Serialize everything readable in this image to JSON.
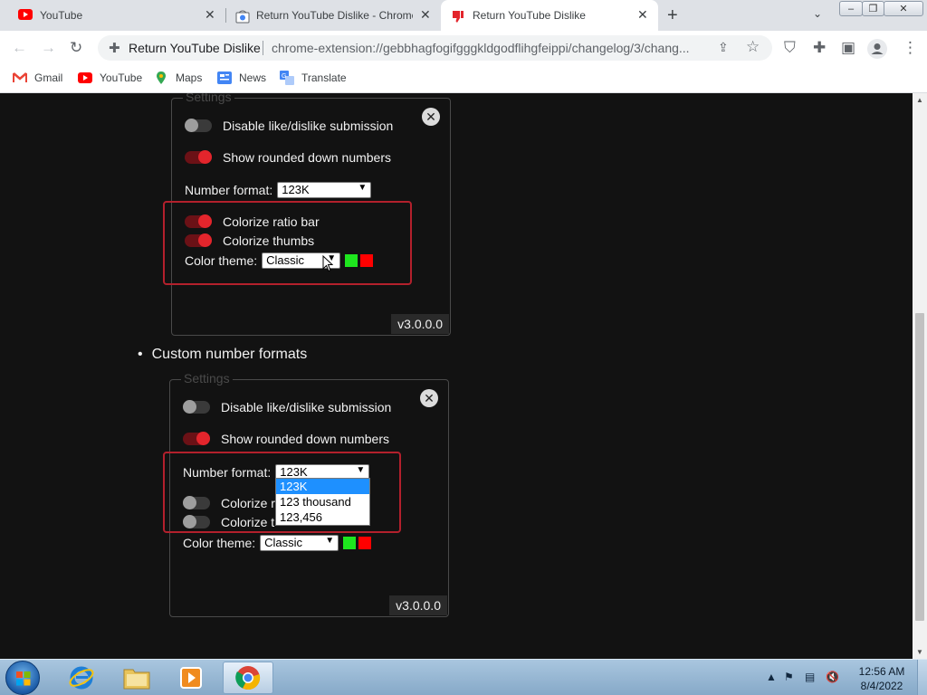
{
  "browser": {
    "tabs": [
      {
        "title": "YouTube",
        "active": false
      },
      {
        "title": "Return YouTube Dislike - Chrome",
        "active": false
      },
      {
        "title": "Return YouTube Dislike",
        "active": true
      }
    ],
    "omnibox": {
      "site_label": "Return YouTube Dislike",
      "url": "chrome-extension://gebbhagfogifgggkldgodflihgfeippi/changelog/3/chang..."
    },
    "bookmarks": [
      "Gmail",
      "YouTube",
      "Maps",
      "News",
      "Translate"
    ]
  },
  "page": {
    "panel1": {
      "legend": "Settings",
      "rows": [
        {
          "label": "Disable like/dislike submission",
          "state": "off"
        },
        {
          "label": "Show rounded down numbers",
          "state": "on"
        },
        {
          "label": "Colorize ratio bar",
          "state": "on"
        },
        {
          "label": "Colorize thumbs",
          "state": "on"
        }
      ],
      "number_format_label": "Number format:",
      "number_format_value": "123K",
      "color_theme_label": "Color theme:",
      "color_theme_value": "Classic",
      "version": "v3.0.0.0"
    },
    "bullet_text": "Custom number formats",
    "panel2": {
      "legend": "Settings",
      "rows": [
        {
          "label": "Disable like/dislike submission",
          "state": "off"
        },
        {
          "label": "Show rounded down numbers",
          "state": "on"
        },
        {
          "label": "Colorize r",
          "state": "off"
        },
        {
          "label": "Colorize t",
          "state": "off"
        }
      ],
      "number_format_label": "Number format:",
      "number_format_value": "123K",
      "dropdown_options": [
        "123K",
        "123 thousand",
        "123,456"
      ],
      "color_theme_label": "Color theme:",
      "color_theme_value": "Classic",
      "version": "v3.0.0.0"
    },
    "colors": {
      "green_swatch": "#1ee61e",
      "red_swatch": "#ff0000",
      "accent": "#e3252c"
    }
  },
  "taskbar": {
    "time": "12:56 AM",
    "date": "8/4/2022"
  }
}
